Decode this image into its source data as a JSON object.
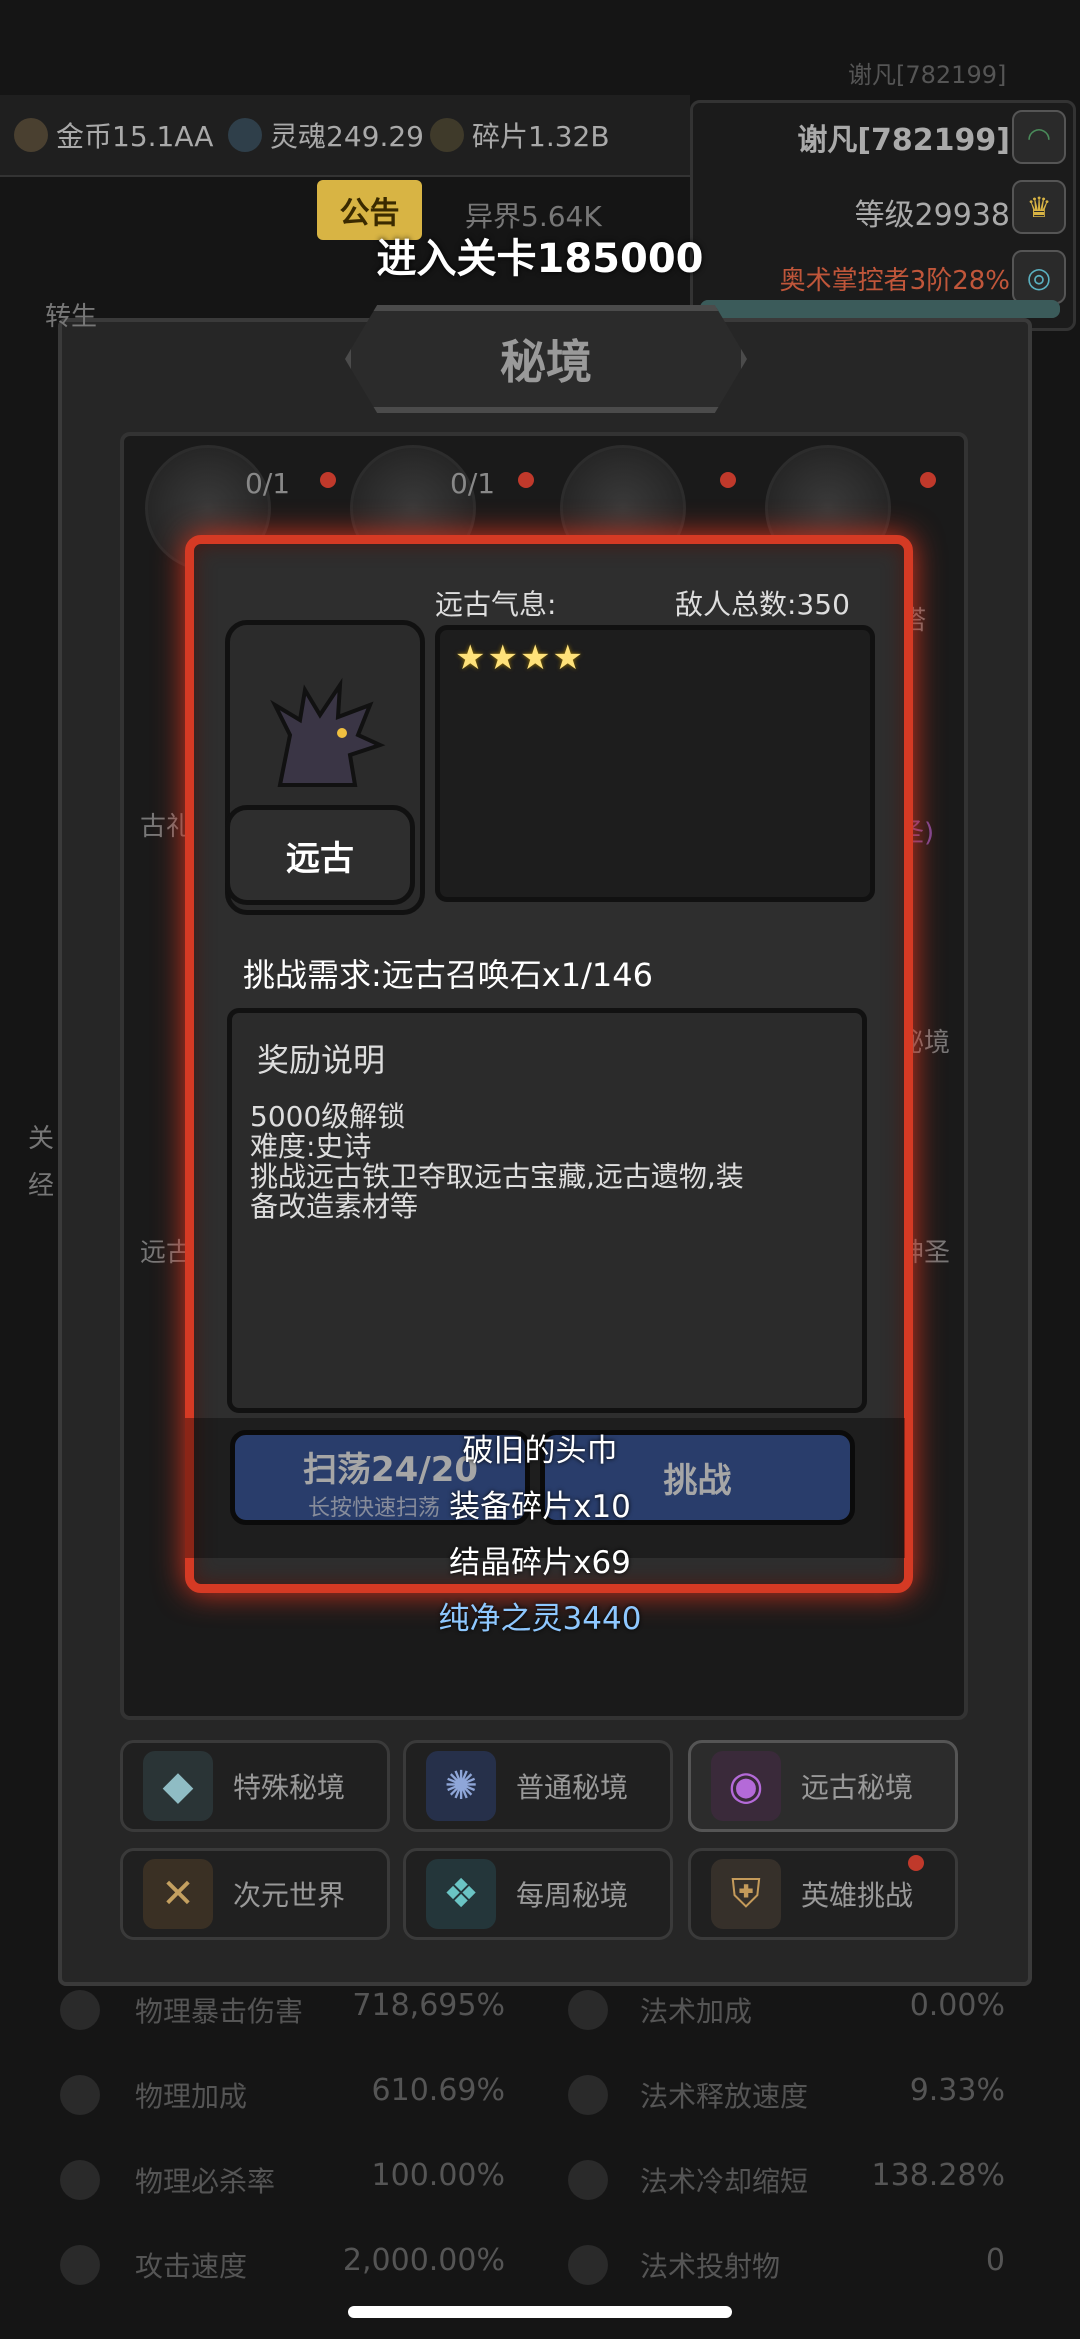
{
  "topbar": {
    "gold": "金币15.1AA",
    "soul": "灵魂249.29",
    "shard": "碎片1.32B",
    "notice_label": "公告",
    "otherworld": "异界5.64K",
    "ghost_id": "谢凡[782199]"
  },
  "player": {
    "name": "谢凡[782199]",
    "level": "等级29938",
    "rank": "奥术掌控者3阶28%"
  },
  "banner": "进入关卡185000",
  "window_title": "秘境",
  "dungeon_nodes": [
    {
      "count": "0/1"
    },
    {
      "count": "0/1"
    }
  ],
  "background_labels": {
    "left": [
      "古礼",
      "远古",
      "关",
      "经",
      "转生"
    ],
    "right": [
      "塔",
      "圣)",
      "秘境",
      "神圣"
    ]
  },
  "modal": {
    "portrait_label": "远古",
    "aura_label": "远古气息:",
    "enemy_count": "敌人总数:350",
    "stars": "★★★★",
    "star_rating": 4,
    "requirement": "挑战需求:远古召唤石x1/146",
    "reward_title": "奖励说明",
    "reward_lines": [
      "5000级解锁",
      "难度:史诗",
      "挑战远古铁卫夺取远古宝藏,远古遗物,装",
      "备改造素材等"
    ],
    "sweep_label": "扫荡24/20",
    "sweep_hint": "长按快速扫荡",
    "challenge_label": "挑战"
  },
  "drops": [
    "破旧的头巾",
    "装备碎片x10",
    "结晶碎片x69",
    "纯净之灵3440"
  ],
  "categories": [
    {
      "label": "特殊秘境",
      "icon": "special-realm-icon"
    },
    {
      "label": "普通秘境",
      "icon": "normal-realm-icon"
    },
    {
      "label": "远古秘境",
      "icon": "ancient-realm-icon"
    },
    {
      "label": "次元世界",
      "icon": "dimension-world-icon"
    },
    {
      "label": "每周秘境",
      "icon": "weekly-realm-icon"
    },
    {
      "label": "英雄挑战",
      "icon": "hero-challenge-icon"
    }
  ],
  "stats": [
    {
      "name": "物理暴击伤害",
      "value": "718,695%",
      "name2": "法术加成",
      "value2": "0.00%"
    },
    {
      "name": "物理加成",
      "value": "610.69%",
      "name2": "法术释放速度",
      "value2": "9.33%"
    },
    {
      "name": "物理必杀率",
      "value": "100.00%",
      "name2": "法术冷却缩短",
      "value2": "138.28%"
    },
    {
      "name": "攻击速度",
      "value": "2,000.00%",
      "name2": "法术投射物",
      "value2": "0"
    }
  ],
  "colors": {
    "modal_border": "#d53a24",
    "button_blue": "#3f5fa5",
    "drop_pure_spirit": "#8ec8ff",
    "star": "#ffe27a"
  }
}
